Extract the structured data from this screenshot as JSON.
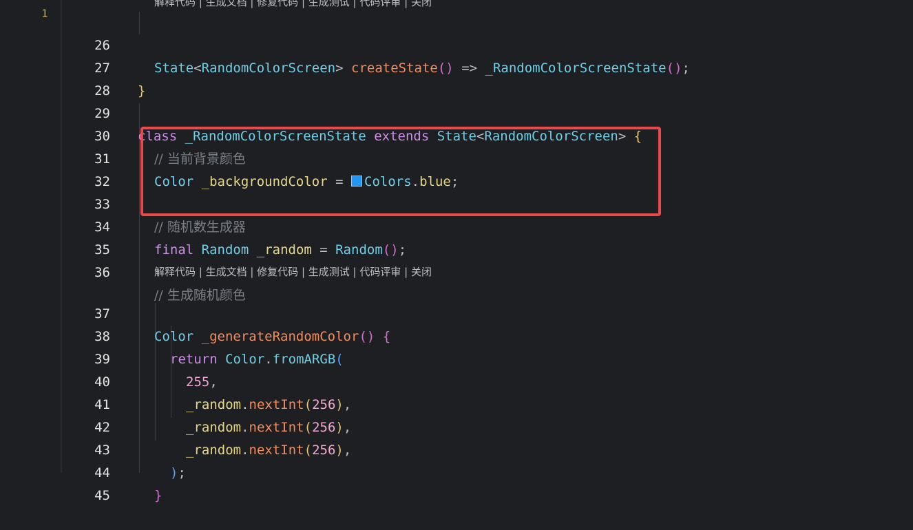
{
  "gutter_marker": "1",
  "code_lens_top": "解释代码 | 生成文档 | 修复代码 | 生成测试 | 代码评审 | 关闭",
  "code_lens_mid": "解释代码 | 生成文档 | 修复代码 | 生成测试 | 代码评审 | 关闭",
  "highlight_color": "#e8494d",
  "swatch_color": "#2196f3",
  "lines": {
    "l26": {
      "num": "26",
      "t1": "State",
      "t2": "<",
      "t3": "RandomColorScreen",
      "t4": "> ",
      "t5": "createState",
      "t6": "()",
      "t7": " => ",
      "t8": "_RandomColorScreenState",
      "t9": "()",
      "t10": ";"
    },
    "l27": {
      "num": "27",
      "t1": "}"
    },
    "l28": {
      "num": "28"
    },
    "l29": {
      "num": "29",
      "t1": "class",
      "t2": " _RandomColorScreenState ",
      "t3": "extends",
      "t4": " ",
      "t5": "State",
      "t6": "<",
      "t7": "RandomColorScreen",
      "t8": "> ",
      "t9": "{"
    },
    "l30": {
      "num": "30",
      "t1": "// 当前背景颜色"
    },
    "l31": {
      "num": "31",
      "t1": "Color",
      "t2": " ",
      "t3": "_backgroundColor",
      "t4": " = ",
      "t5": "Colors",
      "t6": ".",
      "t7": "blue",
      "t8": ";"
    },
    "l32": {
      "num": "32"
    },
    "l33": {
      "num": "33",
      "t1": "// 随机数生成器"
    },
    "l34": {
      "num": "34",
      "t1": "final",
      "t2": " ",
      "t3": "Random",
      "t4": " ",
      "t5": "_random",
      "t6": " = ",
      "t7": "Random",
      "t8": "()",
      "t9": ";"
    },
    "l35": {
      "num": "35"
    },
    "l36": {
      "num": "36",
      "t1": "// 生成随机颜色"
    },
    "l37": {
      "num": "37",
      "t1": "Color",
      "t2": " ",
      "t3": "_generateRandomColor",
      "t4": "()",
      "t5": " ",
      "t6": "{"
    },
    "l38": {
      "num": "38",
      "t1": "return",
      "t2": " ",
      "t3": "Color",
      "t4": ".",
      "t5": "fromARGB",
      "t6": "("
    },
    "l39": {
      "num": "39",
      "t1": "255",
      "t2": ","
    },
    "l40": {
      "num": "40",
      "t1": "_random",
      "t2": ".",
      "t3": "nextInt",
      "t4": "(",
      "t5": "256",
      "t6": ")",
      "t7": ","
    },
    "l41": {
      "num": "41",
      "t1": "_random",
      "t2": ".",
      "t3": "nextInt",
      "t4": "(",
      "t5": "256",
      "t6": ")",
      "t7": ","
    },
    "l42": {
      "num": "42",
      "t1": "_random",
      "t2": ".",
      "t3": "nextInt",
      "t4": "(",
      "t5": "256",
      "t6": ")",
      "t7": ","
    },
    "l43": {
      "num": "43",
      "t1": ")",
      "t2": ";"
    },
    "l44": {
      "num": "44",
      "t1": "}"
    },
    "l45": {
      "num": "45"
    }
  }
}
